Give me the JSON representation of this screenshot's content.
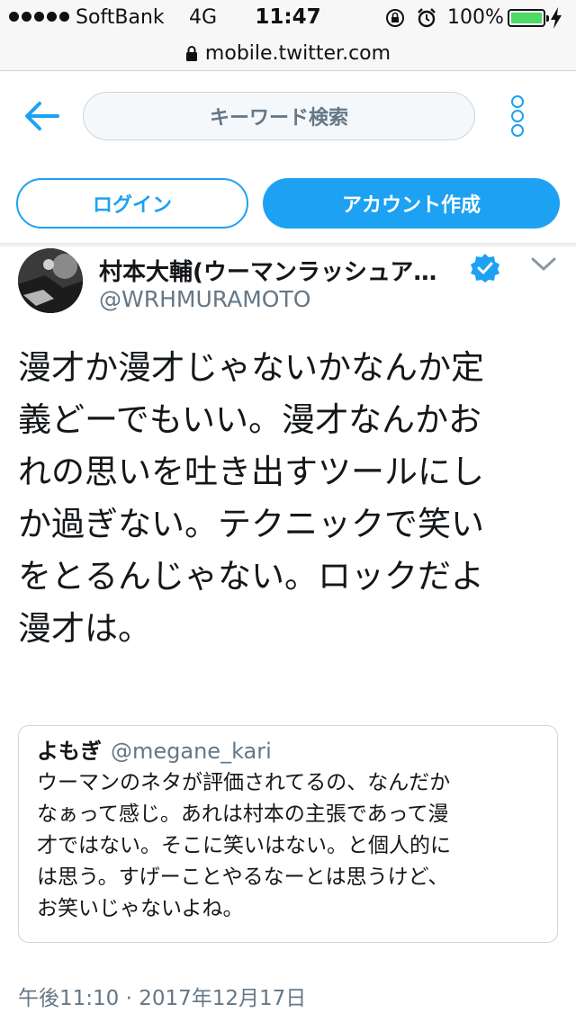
{
  "status_bar": {
    "carrier": "SoftBank",
    "network": "4G",
    "time": "11:47",
    "battery_percent": "100%",
    "battery_level": 1.0,
    "signal_bars": 5,
    "icons": [
      "rotation-lock-icon",
      "alarm-icon",
      "battery-icon",
      "charging-icon"
    ]
  },
  "browser": {
    "url": "mobile.twitter.com"
  },
  "nav": {
    "search_placeholder": "キーワード検索",
    "back_icon": "back-arrow-icon",
    "menu_icon": "more-vertical-icon"
  },
  "auth": {
    "login_label": "ログイン",
    "signup_label": "アカウント作成"
  },
  "tweet": {
    "display_name": "村本大輔(ウーマンラッシュア…",
    "handle": "@WRHMURAMOTO",
    "verified": true,
    "text": "漫才か漫才じゃないかなんか定\n義どーでもいい。漫才なんかお\nれの思いを吐き出すツールにし\nか過ぎない。テクニックで笑い\nをとるんじゃない。ロックだよ\n漫才は。",
    "quoted": {
      "display_name": "よもぎ",
      "handle": "@megane_kari",
      "text": "ウーマンのネタが評価されてるの、なんだか\nなぁって感じ。あれは村本の主張であって漫\n才ではない。そこに笑いはない。と個人的に\nは思う。すげーことやるなーとは思うけど、\nお笑いじゃないよね。"
    },
    "timestamp": "午後11:10 · 2017年12月17日"
  },
  "colors": {
    "accent": "#1da1f2",
    "secondary_text": "#657786",
    "border": "#ccd6dd"
  }
}
